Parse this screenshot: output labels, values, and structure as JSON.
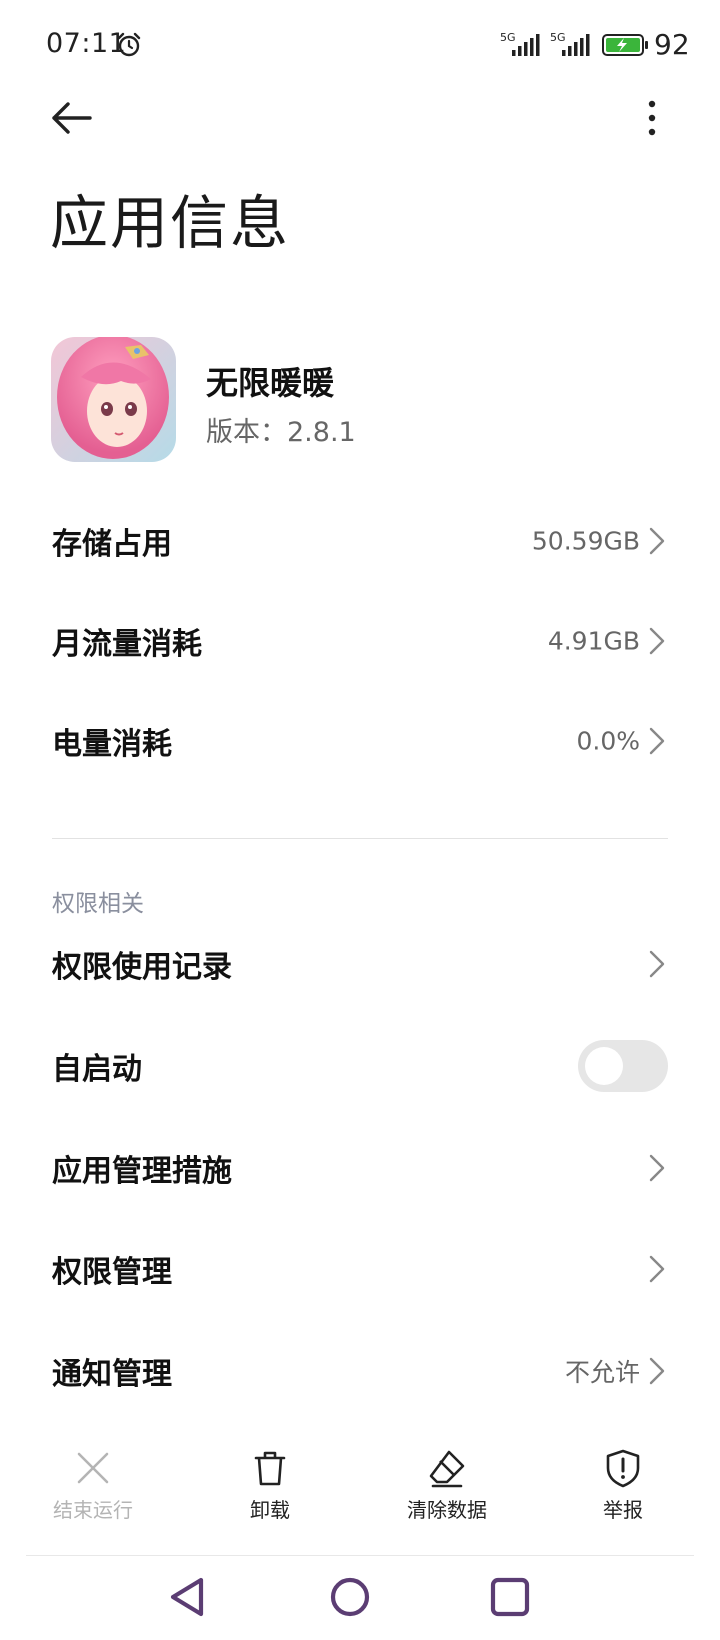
{
  "status_bar": {
    "time": "07:11",
    "signal1_label": "5G",
    "signal2_label": "5G",
    "battery": "92",
    "icons": [
      "alarm-icon",
      "signal-icon",
      "signal-icon",
      "battery-charging-icon"
    ]
  },
  "top_bar": {
    "back_icon": "back-arrow-icon",
    "more_icon": "more-vertical-icon"
  },
  "page": {
    "title": "应用信息"
  },
  "app": {
    "name": "无限暖暖",
    "version_label": "版本：",
    "version": "2.8.1"
  },
  "usage": [
    {
      "label": "存储占用",
      "value": "50.59GB"
    },
    {
      "label": "月流量消耗",
      "value": "4.91GB"
    },
    {
      "label": "电量消耗",
      "value": "0.0%"
    }
  ],
  "permissions": {
    "header": "权限相关",
    "items": [
      {
        "label": "权限使用记录",
        "value": ""
      },
      {
        "label": "自启动",
        "toggle": false
      },
      {
        "label": "应用管理措施",
        "value": ""
      },
      {
        "label": "权限管理",
        "value": ""
      },
      {
        "label": "通知管理",
        "value": "不允许"
      }
    ]
  },
  "actions": [
    {
      "label": "结束运行",
      "icon": "close-icon",
      "enabled": false
    },
    {
      "label": "卸载",
      "icon": "trash-icon",
      "enabled": true
    },
    {
      "label": "清除数据",
      "icon": "eraser-icon",
      "enabled": true
    },
    {
      "label": "举报",
      "icon": "report-shield-icon",
      "enabled": true
    }
  ],
  "nav": {
    "icons": [
      "nav-back-icon",
      "nav-home-icon",
      "nav-recents-icon"
    ],
    "color": "#5b3d73"
  },
  "colors": {
    "battery_green": "#3bb53b",
    "secondary_text": "#666666",
    "section_header": "#8a8f9e"
  }
}
